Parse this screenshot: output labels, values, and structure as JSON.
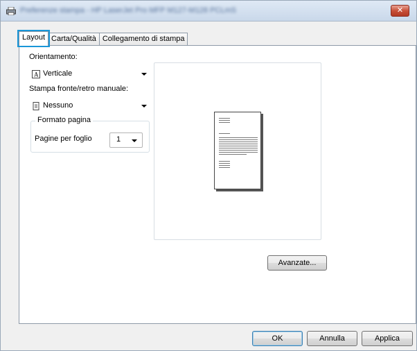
{
  "window": {
    "title": "Preferenze stampa - HP LaserJet Pro MFP M127-M128 PCLmS",
    "close_label": "✕"
  },
  "tabs": [
    {
      "label": "Layout",
      "active": true
    },
    {
      "label": "Carta/Qualità",
      "active": false
    },
    {
      "label": "Collegamento di stampa",
      "active": false
    }
  ],
  "layout": {
    "orientation_label": "Orientamento:",
    "orientation_value": "Verticale",
    "duplex_label": "Stampa fronte/retro manuale:",
    "duplex_value": "Nessuno",
    "page_format_group": "Formato pagina",
    "pages_per_sheet_label": "Pagine per foglio",
    "pages_per_sheet_value": "1",
    "advanced_button": "Avanzate..."
  },
  "footer": {
    "ok_button": "OK",
    "cancel_button": "Annulla",
    "apply_button": "Applica"
  },
  "colors": {
    "tab_focus": "#1996d8",
    "close_button": "#c8503a",
    "title_text": "#3b5a88"
  },
  "icons": {
    "title": "printer-icon",
    "orientation": "portrait-page-icon",
    "duplex": "single-sided-page-icon"
  }
}
